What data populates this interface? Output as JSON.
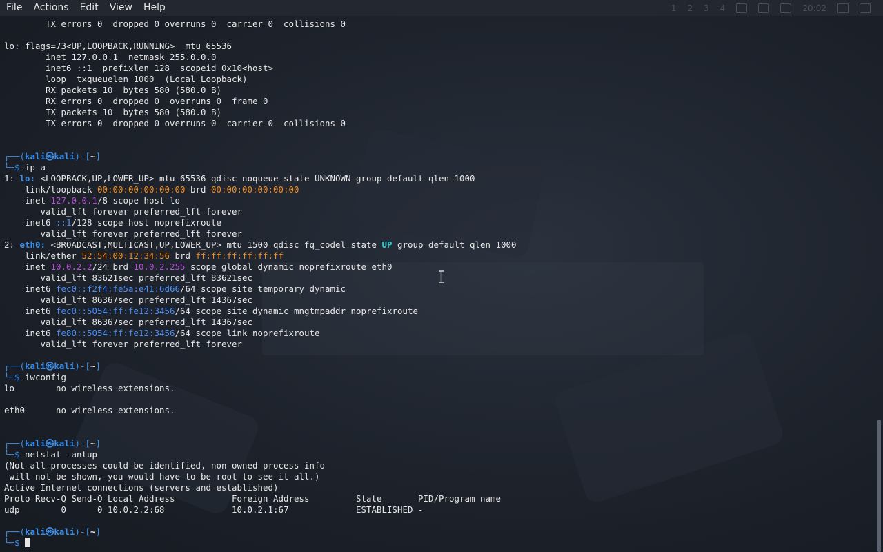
{
  "menubar": {
    "items": [
      "File",
      "Actions",
      "Edit",
      "View",
      "Help"
    ],
    "workspaces": [
      "1",
      "2",
      "3",
      "4"
    ],
    "clock": "20:02"
  },
  "prompt": {
    "user": "kali",
    "host": "kali",
    "dir": "~",
    "separator": "㉿"
  },
  "terminal": {
    "lines": [
      [
        {
          "t": "        TX errors 0  dropped 0 overruns 0  carrier 0  collisions 0",
          "c": "g"
        }
      ],
      [
        {
          "t": "",
          "c": "g"
        }
      ],
      [
        {
          "t": "lo: flags=73<UP,LOOPBACK,RUNNING>  mtu 65536",
          "c": "g"
        }
      ],
      [
        {
          "t": "        inet 127.0.0.1  netmask 255.0.0.0",
          "c": "g"
        }
      ],
      [
        {
          "t": "        inet6 ::1  prefixlen 128  scopeid 0x10<host>",
          "c": "g"
        }
      ],
      [
        {
          "t": "        loop  txqueuelen 1000  (Local Loopback)",
          "c": "g"
        }
      ],
      [
        {
          "t": "        RX packets 10  bytes 580 (580.0 B)",
          "c": "g"
        }
      ],
      [
        {
          "t": "        RX errors 0  dropped 0  overruns 0  frame 0",
          "c": "g"
        }
      ],
      [
        {
          "t": "        TX packets 10  bytes 580 (580.0 B)",
          "c": "g"
        }
      ],
      [
        {
          "t": "        TX errors 0  dropped 0 overruns 0  carrier 0  collisions 0",
          "c": "g"
        }
      ],
      [
        {
          "t": "",
          "c": "g"
        }
      ],
      [
        {
          "t": "",
          "c": "g"
        }
      ],
      [
        {
          "t": "┌──(",
          "c": "pfx"
        },
        {
          "t": "kali㉿kali",
          "c": "kali"
        },
        {
          "t": ")-[",
          "c": "pfx"
        },
        {
          "t": "~",
          "c": "tilde"
        },
        {
          "t": "]",
          "c": "pfx"
        }
      ],
      [
        {
          "t": "└─$ ",
          "c": "pfx"
        },
        {
          "t": "ip a",
          "c": "cmd"
        }
      ],
      [
        {
          "t": "1: ",
          "c": "g"
        },
        {
          "t": "lo: ",
          "c": "bblue"
        },
        {
          "t": "<LOOPBACK,UP,LOWER_UP> mtu 65536 qdisc noqueue state UNKNOWN group default qlen 1000",
          "c": "g"
        }
      ],
      [
        {
          "t": "    link/loopback ",
          "c": "g"
        },
        {
          "t": "00:00:00:00:00:00",
          "c": "orange"
        },
        {
          "t": " brd ",
          "c": "g"
        },
        {
          "t": "00:00:00:00:00:00",
          "c": "orange"
        }
      ],
      [
        {
          "t": "    inet ",
          "c": "g"
        },
        {
          "t": "127.0.0.1",
          "c": "purple"
        },
        {
          "t": "/8 scope host lo",
          "c": "g"
        }
      ],
      [
        {
          "t": "       valid_lft forever preferred_lft forever",
          "c": "g"
        }
      ],
      [
        {
          "t": "    inet6 ",
          "c": "g"
        },
        {
          "t": "::1",
          "c": "ipv6"
        },
        {
          "t": "/128 scope host noprefixroute",
          "c": "g"
        }
      ],
      [
        {
          "t": "       valid_lft forever preferred_lft forever",
          "c": "g"
        }
      ],
      [
        {
          "t": "2: ",
          "c": "g"
        },
        {
          "t": "eth0: ",
          "c": "bblue"
        },
        {
          "t": "<BROADCAST,MULTICAST,UP,LOWER_UP> mtu 1500 qdisc fq_codel state ",
          "c": "g"
        },
        {
          "t": "UP",
          "c": "cyan"
        },
        {
          "t": " group default qlen 1000",
          "c": "g"
        }
      ],
      [
        {
          "t": "    link/ether ",
          "c": "g"
        },
        {
          "t": "52:54:00:12:34:56",
          "c": "orange"
        },
        {
          "t": " brd ",
          "c": "g"
        },
        {
          "t": "ff:ff:ff:ff:ff:ff",
          "c": "orange"
        }
      ],
      [
        {
          "t": "    inet ",
          "c": "g"
        },
        {
          "t": "10.0.2.2",
          "c": "purple"
        },
        {
          "t": "/24 brd ",
          "c": "g"
        },
        {
          "t": "10.0.2.255",
          "c": "purple"
        },
        {
          "t": " scope global dynamic noprefixroute eth0",
          "c": "g"
        }
      ],
      [
        {
          "t": "       valid_lft 83621sec preferred_lft 83621sec",
          "c": "g"
        }
      ],
      [
        {
          "t": "    inet6 ",
          "c": "g"
        },
        {
          "t": "fec0::f2f4:fe5a:e41:6d66",
          "c": "ipv6"
        },
        {
          "t": "/64 scope site temporary dynamic",
          "c": "g"
        }
      ],
      [
        {
          "t": "       valid_lft 86367sec preferred_lft 14367sec",
          "c": "g"
        }
      ],
      [
        {
          "t": "    inet6 ",
          "c": "g"
        },
        {
          "t": "fec0::5054:ff:fe12:3456",
          "c": "ipv6"
        },
        {
          "t": "/64 scope site dynamic mngtmpaddr noprefixroute",
          "c": "g"
        }
      ],
      [
        {
          "t": "       valid_lft 86367sec preferred_lft 14367sec",
          "c": "g"
        }
      ],
      [
        {
          "t": "    inet6 ",
          "c": "g"
        },
        {
          "t": "fe80::5054:ff:fe12:3456",
          "c": "ipv6"
        },
        {
          "t": "/64 scope link noprefixroute",
          "c": "g"
        }
      ],
      [
        {
          "t": "       valid_lft forever preferred_lft forever",
          "c": "g"
        }
      ],
      [
        {
          "t": "",
          "c": "g"
        }
      ],
      [
        {
          "t": "┌──(",
          "c": "pfx"
        },
        {
          "t": "kali㉿kali",
          "c": "kali"
        },
        {
          "t": ")-[",
          "c": "pfx"
        },
        {
          "t": "~",
          "c": "tilde"
        },
        {
          "t": "]",
          "c": "pfx"
        }
      ],
      [
        {
          "t": "└─$ ",
          "c": "pfx"
        },
        {
          "t": "iwconfig",
          "c": "cmd"
        }
      ],
      [
        {
          "t": "lo        no wireless extensions.",
          "c": "g"
        }
      ],
      [
        {
          "t": "",
          "c": "g"
        }
      ],
      [
        {
          "t": "eth0      no wireless extensions.",
          "c": "g"
        }
      ],
      [
        {
          "t": "",
          "c": "g"
        }
      ],
      [
        {
          "t": "",
          "c": "g"
        }
      ],
      [
        {
          "t": "┌──(",
          "c": "pfx"
        },
        {
          "t": "kali㉿kali",
          "c": "kali"
        },
        {
          "t": ")-[",
          "c": "pfx"
        },
        {
          "t": "~",
          "c": "tilde"
        },
        {
          "t": "]",
          "c": "pfx"
        }
      ],
      [
        {
          "t": "└─$ ",
          "c": "pfx"
        },
        {
          "t": "netstat -antup",
          "c": "cmd"
        }
      ],
      [
        {
          "t": "(Not all processes could be identified, non-owned process info",
          "c": "g"
        }
      ],
      [
        {
          "t": " will not be shown, you would have to be root to see it all.)",
          "c": "g"
        }
      ],
      [
        {
          "t": "Active Internet connections (servers and established)",
          "c": "g"
        }
      ],
      [
        {
          "t": "Proto Recv-Q Send-Q Local Address           Foreign Address         State       PID/Program name",
          "c": "g"
        }
      ],
      [
        {
          "t": "udp        0      0 10.0.2.2:68             10.0.2.1:67             ESTABLISHED -",
          "c": "g"
        }
      ],
      [
        {
          "t": "",
          "c": "g"
        }
      ],
      [
        {
          "t": "┌──(",
          "c": "pfx"
        },
        {
          "t": "kali㉿kali",
          "c": "kali"
        },
        {
          "t": ")-[",
          "c": "pfx"
        },
        {
          "t": "~",
          "c": "tilde"
        },
        {
          "t": "]",
          "c": "pfx"
        }
      ],
      [
        {
          "t": "└─$ ",
          "c": "pfx"
        },
        {
          "t": "",
          "c": "cmd"
        }
      ]
    ]
  },
  "colors": {
    "prompt_frame": "#3b8eea",
    "mac": "#f08c22",
    "ipv4": "#b64fd9",
    "ipv6": "#4b8ef6",
    "state_up": "#37c7c7",
    "text": "#e7e7e7",
    "background": "#1f2530"
  }
}
